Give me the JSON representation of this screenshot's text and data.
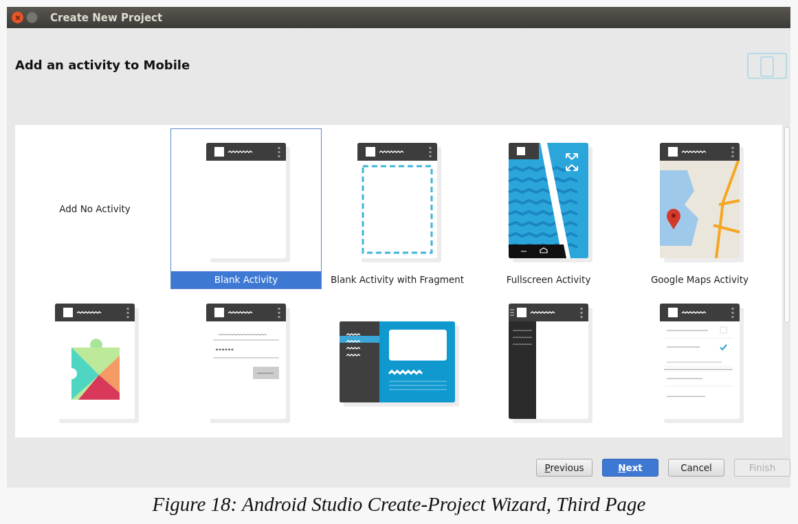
{
  "window": {
    "title": "Create New Project"
  },
  "heading": "Add an activity to Mobile",
  "templates": [
    {
      "kind": "none",
      "label": "Add No Activity",
      "selected": false
    },
    {
      "kind": "blank",
      "label": "Blank Activity",
      "selected": true
    },
    {
      "kind": "fragment",
      "label": "Blank Activity with Fragment",
      "selected": false
    },
    {
      "kind": "fullscreen",
      "label": "Fullscreen Activity",
      "selected": false
    },
    {
      "kind": "maps",
      "label": "Google Maps Activity",
      "selected": false
    },
    {
      "kind": "play",
      "selected": false
    },
    {
      "kind": "login",
      "selected": false
    },
    {
      "kind": "master",
      "selected": false
    },
    {
      "kind": "drawer",
      "selected": false
    },
    {
      "kind": "settings",
      "selected": false
    }
  ],
  "buttons": [
    {
      "access_key": "P",
      "label": "revious",
      "kind": "secondary",
      "disabled": false
    },
    {
      "access_key": "N",
      "label": "ext",
      "kind": "primary",
      "disabled": false
    },
    {
      "label": "Cancel",
      "kind": "secondary",
      "disabled": false
    },
    {
      "label": "Finish",
      "kind": "secondary",
      "disabled": true
    }
  ],
  "caption": "Figure 18: Android Studio Create-Project Wizard, Third Page"
}
